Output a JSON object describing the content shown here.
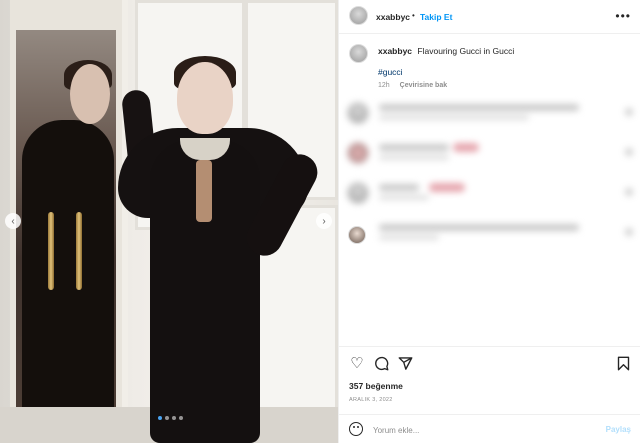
{
  "header": {
    "username": "xxabbyc",
    "separator": "•",
    "follow_label": "Takip Et",
    "more_icon": "more-horizontal-icon"
  },
  "caption": {
    "username": "xxabbyc",
    "text": "Flavouring Gucci in Gucci",
    "hashtag": "#gucci",
    "time": "12h",
    "translate_label": "Çevirisine bak"
  },
  "comments": [
    {
      "blurred": true
    },
    {
      "blurred": true
    },
    {
      "blurred": true
    },
    {
      "blurred": true
    }
  ],
  "actions": {
    "like_icon": "heart-icon",
    "comment_icon": "comment-icon",
    "share_icon": "share-icon",
    "save_icon": "bookmark-icon",
    "likes": "357 beğenme",
    "date": "ARALIK 3, 2022"
  },
  "comment_box": {
    "placeholder": "Yorum ekle...",
    "post_label": "Paylaş"
  },
  "carousel": {
    "prev_glyph": "‹",
    "next_glyph": "›",
    "slide_count": 4,
    "active_slide": 1
  },
  "colors": {
    "accent": "#0095f6",
    "text": "#262626",
    "muted": "#8e8e8e"
  }
}
